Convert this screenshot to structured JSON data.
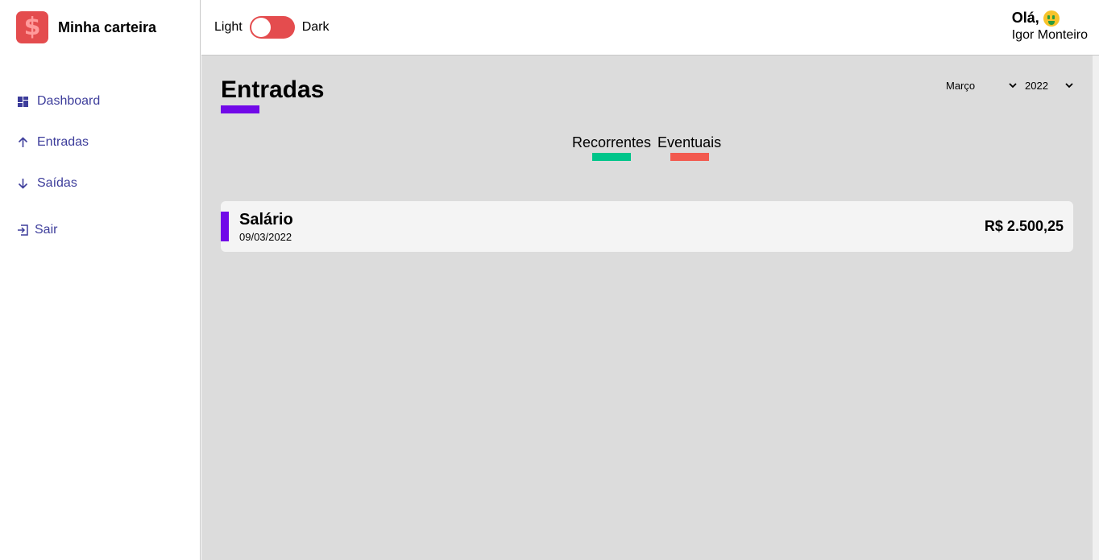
{
  "brand": {
    "logo_symbol": "$",
    "title": "Minha carteira",
    "color": "#e44c4e"
  },
  "menu": {
    "items": [
      {
        "label": "Dashboard",
        "icon": "dashboard-icon"
      },
      {
        "label": "Entradas",
        "icon": "arrow-up-icon"
      },
      {
        "label": "Saídas",
        "icon": "arrow-down-icon"
      },
      {
        "label": "Sair",
        "icon": "exit-icon"
      }
    ]
  },
  "header": {
    "theme_light_label": "Light",
    "theme_dark_label": "Dark",
    "greeting": "Olá,",
    "greeting_emoji": "money-mouth-face-icon",
    "user_name": "Igor Monteiro"
  },
  "page": {
    "title": "Entradas",
    "accent_color": "#7109e8",
    "month_selected": "Março",
    "year_selected": "2022"
  },
  "filters": [
    {
      "label": "Recorrentes",
      "color": "#4ae59e"
    },
    {
      "label": "Eventuais",
      "color": "#e44c4e"
    }
  ],
  "transactions": [
    {
      "title": "Salário",
      "date": "09/03/2022",
      "amount": "R$ 2.500,25",
      "tag_color": "#7109e8"
    }
  ]
}
